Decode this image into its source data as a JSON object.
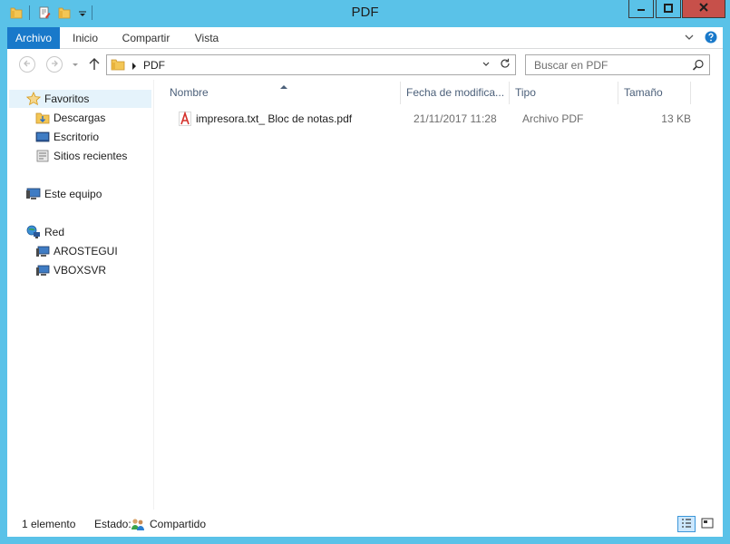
{
  "window": {
    "title": "PDF",
    "controls": {
      "minimize": "minimize-icon",
      "maximize": "maximize-icon",
      "close": "close-icon"
    }
  },
  "quick_access": [
    "folder-icon",
    "properties-icon",
    "new-folder-icon",
    "customize-qat-icon"
  ],
  "ribbon": {
    "tabs": [
      {
        "label": "Archivo",
        "active": true
      },
      {
        "label": "Inicio"
      },
      {
        "label": "Compartir"
      },
      {
        "label": "Vista"
      }
    ]
  },
  "navigation": {
    "back": "back-arrow-icon",
    "forward": "forward-arrow-icon",
    "recent": "recent-locations-icon",
    "up": "up-arrow-icon",
    "breadcrumb": [
      "PDF"
    ],
    "search_placeholder": "Buscar en PDF"
  },
  "sidebar": {
    "groups": [
      {
        "label": "Favoritos",
        "icon": "star-icon",
        "items": [
          {
            "label": "Descargas",
            "icon": "downloads-folder-icon"
          },
          {
            "label": "Escritorio",
            "icon": "desktop-icon"
          },
          {
            "label": "Sitios recientes",
            "icon": "recent-places-icon"
          }
        ]
      },
      {
        "label": "Este equipo",
        "icon": "computer-icon",
        "items": []
      },
      {
        "label": "Red",
        "icon": "network-icon",
        "items": [
          {
            "label": "AROSTEGUI",
            "icon": "network-computer-icon"
          },
          {
            "label": "VBOXSVR",
            "icon": "network-computer-icon"
          }
        ]
      }
    ]
  },
  "file_list": {
    "columns": [
      "Nombre",
      "Fecha de modifica...",
      "Tipo",
      "Tamaño"
    ],
    "sorted_column": "Nombre",
    "rows": [
      {
        "name": "impresora.txt_ Bloc de notas.pdf",
        "modified": "21/11/2017 11:28",
        "type": "Archivo PDF",
        "size": "13 KB",
        "icon": "pdf-file-icon"
      }
    ]
  },
  "status": {
    "count": "1 elemento",
    "state_label": "Estado:",
    "state_value": "Compartido",
    "views": [
      "details-view-icon",
      "large-icons-view-icon"
    ]
  },
  "colors": {
    "window_frame": "#5ac2e8",
    "archivo_tab": "#1979ca",
    "close_button": "#c7504a",
    "selection": "#e5f3fb",
    "column_header_text": "#4c607a"
  }
}
